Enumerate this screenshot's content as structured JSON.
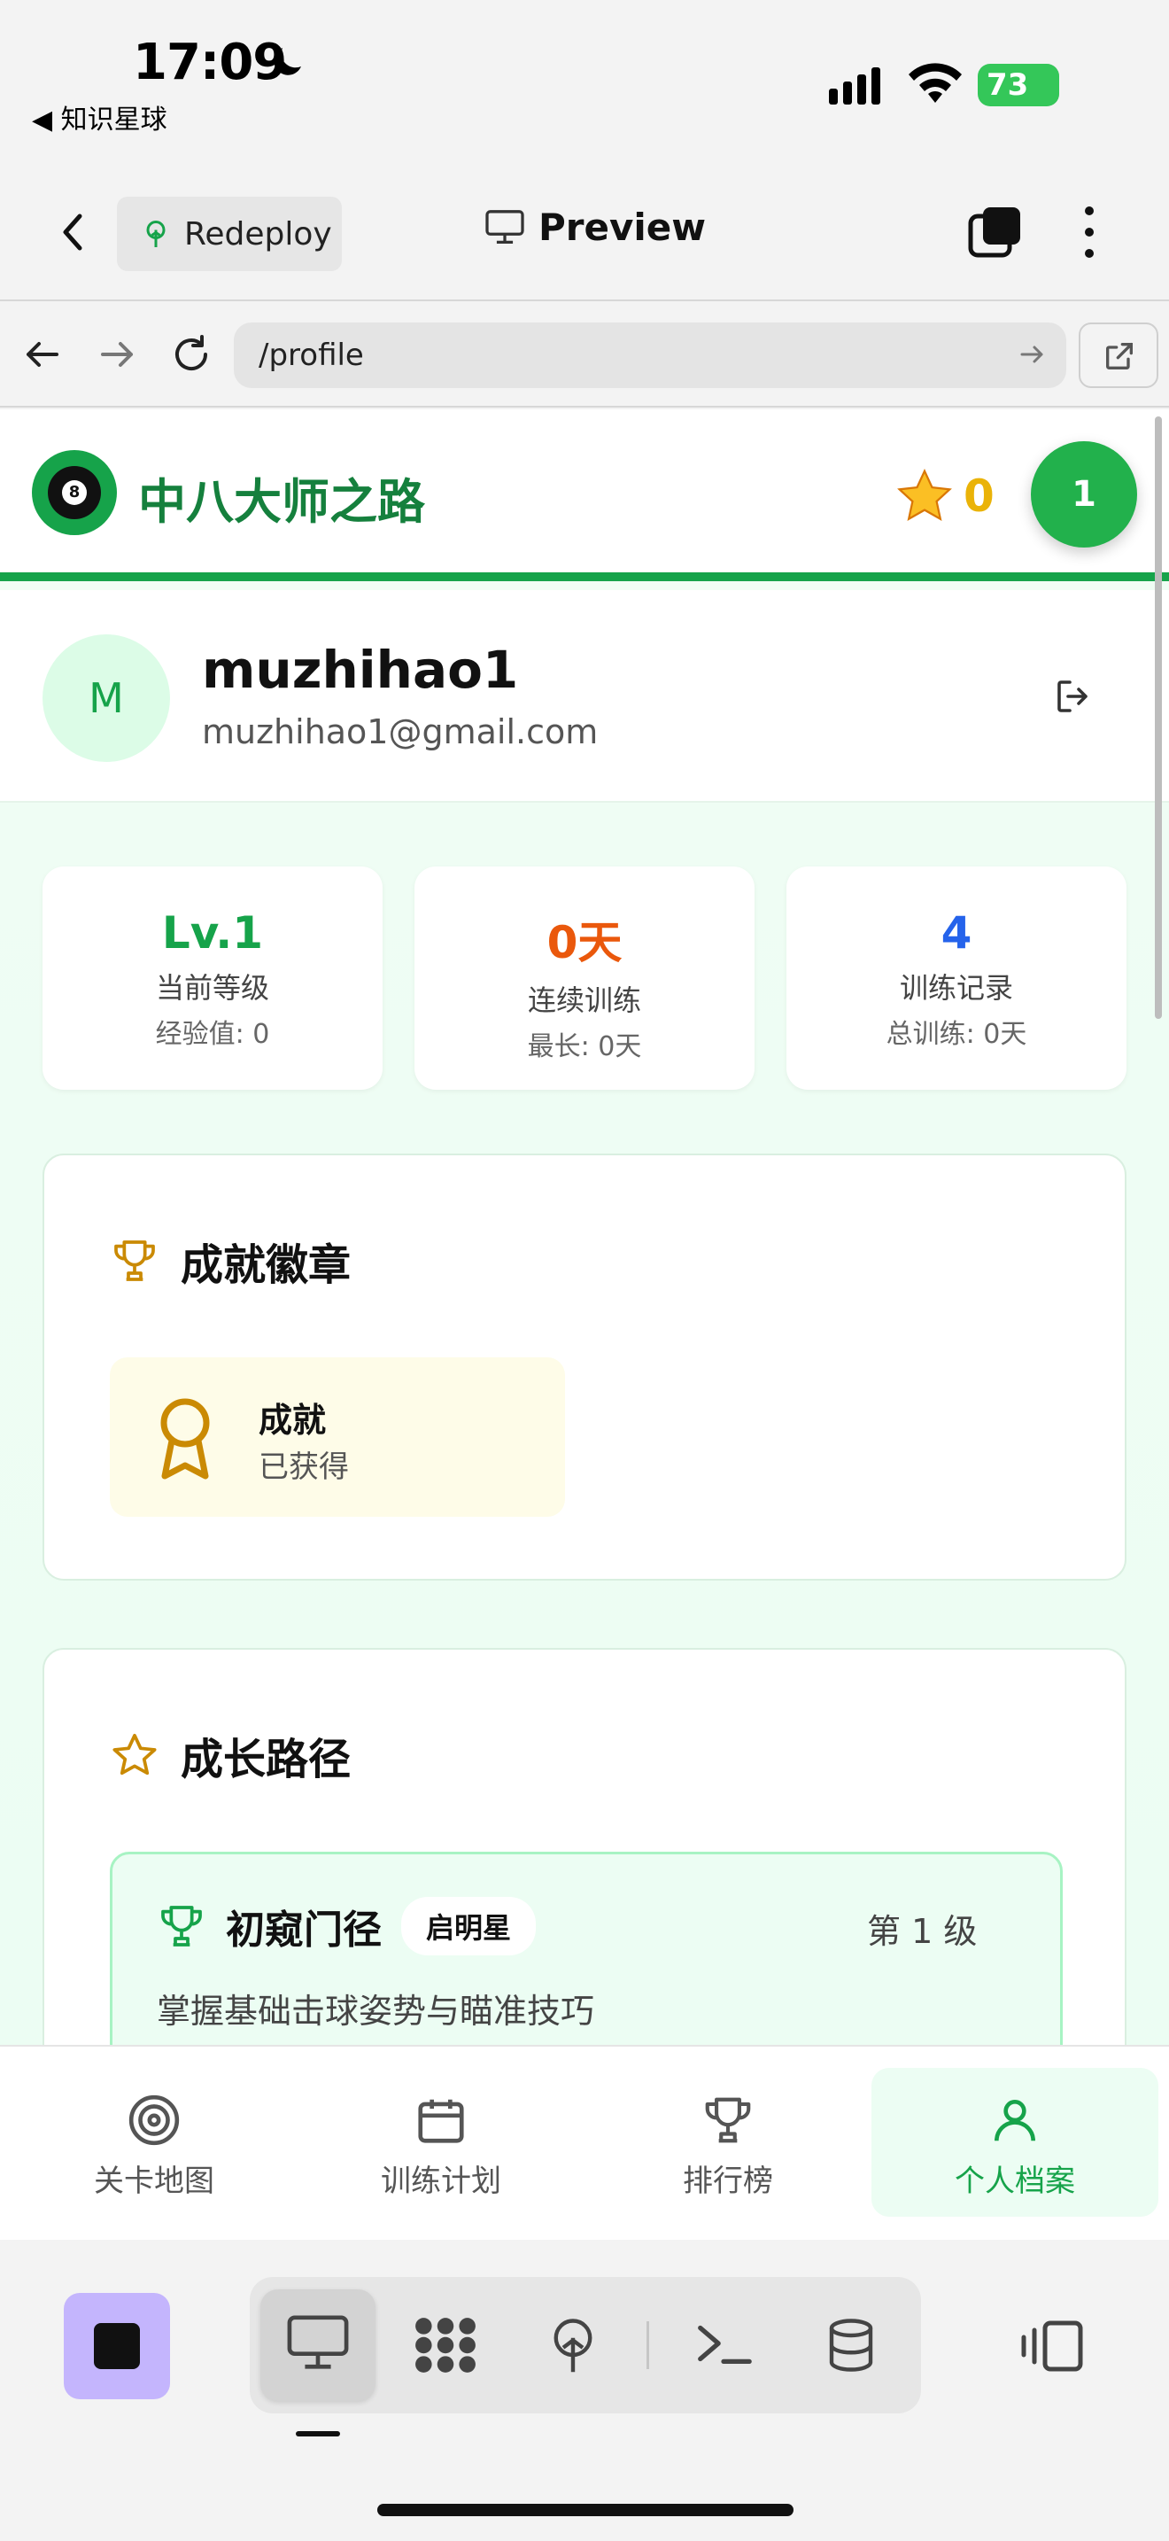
{
  "status_bar": {
    "time": "17:09",
    "back_app": "◀ 知识星球",
    "battery": "73"
  },
  "app_bar": {
    "redeploy_label": "Redeploy",
    "preview_label": "Preview"
  },
  "browser": {
    "url": "/profile"
  },
  "site": {
    "title": "中八大师之路",
    "stars": "0",
    "level_badge": "1"
  },
  "profile": {
    "avatar_letter": "M",
    "username": "muzhihao1",
    "email": "muzhihao1@gmail.com"
  },
  "stats": [
    {
      "value": "Lv.1",
      "label": "当前等级",
      "sub": "经验值: 0",
      "color": "#16a34a"
    },
    {
      "value": "0天",
      "label": "连续训练",
      "sub": "最长: 0天",
      "color": "#ea580c"
    },
    {
      "value": "4",
      "label": "训练记录",
      "sub": "总训练: 0天",
      "color": "#2563eb"
    }
  ],
  "achievements": {
    "title": "成就徽章",
    "badge": {
      "title": "成就",
      "status": "已获得"
    }
  },
  "growth_path": {
    "title": "成长路径",
    "item": {
      "title": "初窥门径",
      "tag": "启明星",
      "level": "第 1 级",
      "desc": "掌握基础击球姿势与瞄准技巧"
    }
  },
  "bottom_nav": [
    {
      "label": "关卡地图",
      "icon": "target-icon"
    },
    {
      "label": "训练计划",
      "icon": "calendar-icon"
    },
    {
      "label": "排行榜",
      "icon": "trophy-icon"
    },
    {
      "label": "个人档案",
      "icon": "user-icon",
      "active": true
    }
  ],
  "colors": {
    "brand_green": "#16a34a",
    "accent_orange": "#ea580c",
    "accent_blue": "#2563eb",
    "gold": "#ca8a04"
  }
}
